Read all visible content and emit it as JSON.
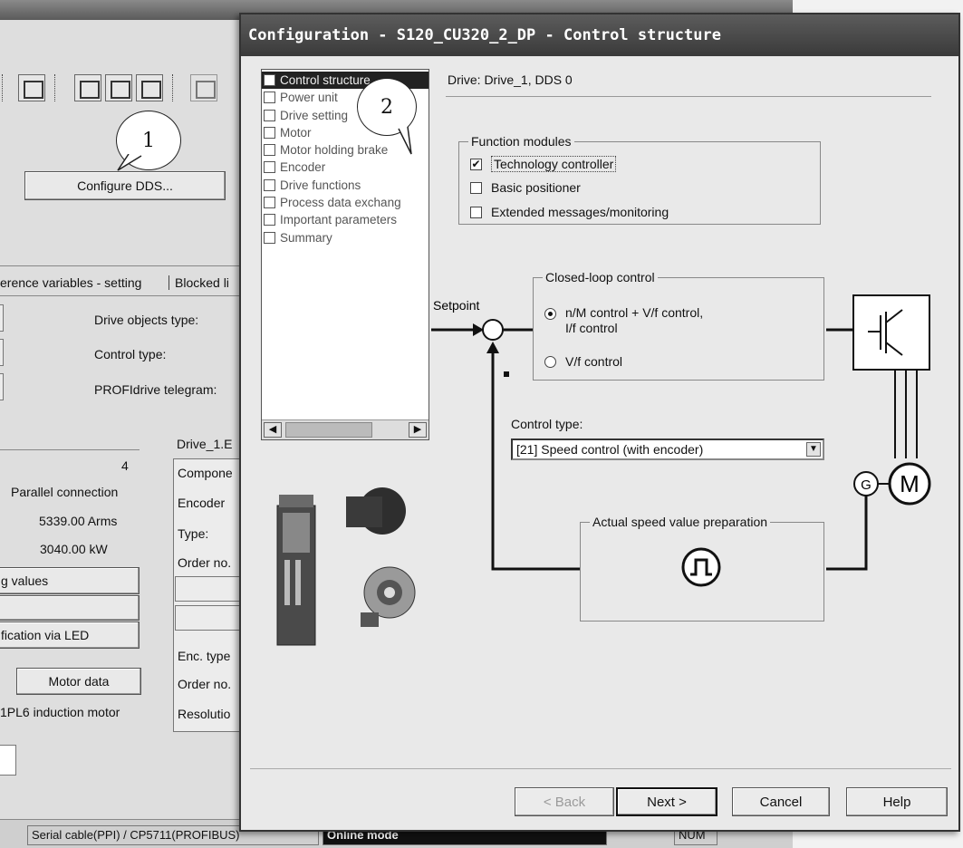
{
  "background": {
    "configure_dds_label": "Configure DDS...",
    "callout_1": "1",
    "tab_strip_text": "erence variables - setting",
    "tab_blocked_label": "Blocked li",
    "drive_objects_type_label": "Drive objects type:",
    "control_type_label": "Control type:",
    "profidrive_label": "PROFIdrive telegram:",
    "motor_count": "4",
    "connection": "Parallel connection",
    "current": "5339.00 Arms",
    "power": "3040.00 kW",
    "values_button": "g values",
    "led_button": "fication via LED",
    "motor_data_button": "Motor data",
    "motor_type": "1PL6 induction motor",
    "drive_header": "Drive_1.E",
    "component_label": "Compone",
    "encoder_label": "Encoder",
    "type_label": "Type:",
    "order_label": "Order no.",
    "enc_type_label": "Enc. type",
    "order_label_2": "Order no.",
    "resolution_label": "Resolutio",
    "status_connection": "Serial cable(PPI) / CP5711(PROFIBUS)",
    "status_mode": "Online mode",
    "status_num": "NUM"
  },
  "dialog": {
    "title": "Configuration - S120_CU320_2_DP - Control structure",
    "callout_2": "2",
    "nav_items": [
      {
        "label": "Control structure",
        "selected": true
      },
      {
        "label": "Power unit",
        "selected": false
      },
      {
        "label": "Drive setting",
        "selected": false
      },
      {
        "label": "Motor",
        "selected": false
      },
      {
        "label": "Motor holding brake",
        "selected": false
      },
      {
        "label": "Encoder",
        "selected": false
      },
      {
        "label": "Drive functions",
        "selected": false
      },
      {
        "label": "Process data exchang",
        "selected": false
      },
      {
        "label": "Important parameters",
        "selected": false
      },
      {
        "label": "Summary",
        "selected": false
      }
    ],
    "drive_label": "Drive: Drive_1, DDS 0",
    "function_modules": {
      "title": "Function modules",
      "technology_controller": "Technology controller",
      "basic_positioner": "Basic positioner",
      "extended_messages": "Extended messages/monitoring"
    },
    "closed_loop": {
      "title": "Closed-loop control",
      "option_nm_line1": "n/M control + V/f control,",
      "option_nm_line2": "I/f control",
      "option_vf": "V/f control"
    },
    "setpoint_label": "Setpoint",
    "minus_sign": "-",
    "control_type_label": "Control type:",
    "control_type_value": "[21] Speed control (with encoder)",
    "actual_speed_title": "Actual speed value preparation",
    "motor_symbol": "M",
    "encoder_symbol": "G",
    "buttons": {
      "back": "< Back",
      "next": "Next >",
      "cancel": "Cancel",
      "help": "Help"
    }
  },
  "colors": {
    "title_bar": "#3a3a3a",
    "dialog_bg": "#e9e9e9",
    "nav_selected": "#222222"
  }
}
